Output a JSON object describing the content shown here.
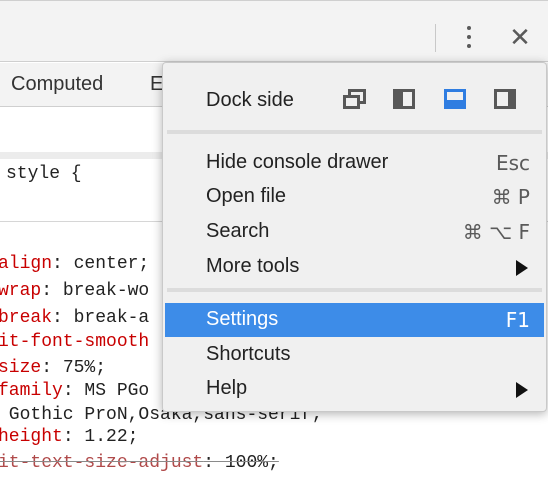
{
  "devtools": {
    "tabs": [
      {
        "label": "Computed"
      },
      {
        "label": "E"
      }
    ],
    "selector_line": "style {",
    "css_lines": [
      {
        "prop": "align",
        "value": ": center;",
        "struck": false
      },
      {
        "prop": "wrap",
        "value": ": break-wo",
        "struck": false
      },
      {
        "prop": "break",
        "value": ": break-a",
        "struck": false
      },
      {
        "prop": "it-font-smooth",
        "value": "",
        "struck": false
      },
      {
        "prop": "size",
        "value": ": 75%;",
        "struck": false
      },
      {
        "prop": "family",
        "value": ": MS PGo",
        "struck": false
      },
      {
        "prop": "",
        "value": " Gothic ProN,Osaka,sans-serif;",
        "struck": false
      },
      {
        "prop": "height",
        "value": ": 1.22;",
        "struck": false
      },
      {
        "prop": "it-text-size-adjust",
        "value": ": 100%;",
        "struck": true
      }
    ]
  },
  "menu": {
    "dock_side_label": "Dock side",
    "dock_options": [
      {
        "icon": "undock-icon",
        "selected": false
      },
      {
        "icon": "dock-left-icon",
        "selected": false
      },
      {
        "icon": "dock-bottom-icon",
        "selected": true
      },
      {
        "icon": "dock-right-icon",
        "selected": false
      }
    ],
    "items": [
      {
        "label": "Hide console drawer",
        "shortcut": "Esc",
        "submenu": false,
        "highlighted": false
      },
      {
        "label": "Open file",
        "shortcut": "⌘ P",
        "submenu": false,
        "highlighted": false
      },
      {
        "label": "Search",
        "shortcut": "⌘ ⌥ F",
        "submenu": false,
        "highlighted": false
      },
      {
        "label": "More tools",
        "shortcut": "",
        "submenu": true,
        "highlighted": false
      },
      {
        "label": "Settings",
        "shortcut": "F1",
        "submenu": false,
        "highlighted": true
      },
      {
        "label": "Shortcuts",
        "shortcut": "",
        "submenu": false,
        "highlighted": false
      },
      {
        "label": "Help",
        "shortcut": "",
        "submenu": true,
        "highlighted": false
      }
    ]
  },
  "colors": {
    "highlight": "#3d8ce8",
    "css_property": "#c80000",
    "dock_selected": "#2f7de1"
  }
}
